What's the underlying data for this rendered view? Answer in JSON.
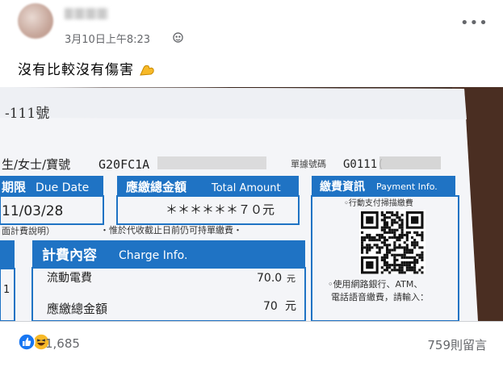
{
  "post": {
    "timestamp": "3月10日上午8:23",
    "text": "沒有比較沒有傷害",
    "audience_icon": "globe-icon",
    "more_icon": "more-dots-icon"
  },
  "bill": {
    "top_fragment": "-111號",
    "customer_label": "生/女士/寶號",
    "customer_id": "G20FC1A",
    "receipt_label": "單據號碼",
    "receipt_no": "G0111(",
    "due_date_label_zh": "期限",
    "due_date_label_en": "Due Date",
    "due_date_value": "11/03/28",
    "total_label_zh": "應繳總金額",
    "total_label_en": "Total Amount",
    "total_value": "＊＊＊＊＊＊７０元",
    "payment_label_zh": "繳費資訊",
    "payment_label_en": "Payment Info.",
    "payment_line1": "◦行動支付掃描繳費",
    "payment_line2": "◦使用網路銀行、ATM、",
    "payment_line3": "電話語音繳費，請輸入：",
    "notice_left": "面計費說明）",
    "notice_right": "・惟於代收截止日前仍可持單繳費・",
    "charge_label_zh": "計費內容",
    "charge_label_en": "Charge Info.",
    "charges": [
      {
        "item": "流動電費",
        "amount": "70.0",
        "unit": "元"
      },
      {
        "item": "應繳總金額",
        "amount": "70",
        "unit": "元"
      }
    ],
    "side_number": "1"
  },
  "stats": {
    "reaction_icons": [
      "like-icon",
      "haha-icon"
    ],
    "reaction_count": "1,685",
    "comment_count": "759則留言"
  },
  "colors": {
    "bill_blue": "#1f73c4",
    "meta_gray": "#65676b",
    "like_blue": "#1877f2",
    "haha_yellow": "#f7b928"
  }
}
